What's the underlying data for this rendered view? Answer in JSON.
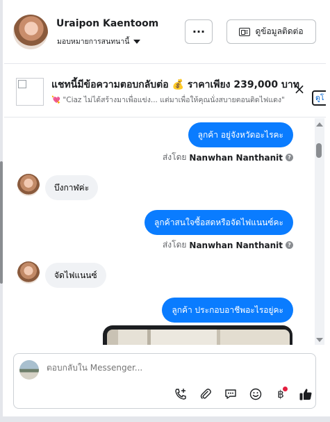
{
  "header": {
    "name": "Uraipon Kaentoom",
    "assign_label": "มอบหมายการสนทนานี้",
    "more_label": "···",
    "contact_label": "ดูข้อมูลติดต่อ"
  },
  "ad": {
    "title": "แชทนี้มีข้อความตอบกลับต่อ 💰 ราคาเพียง 239,000 บาท",
    "subtitle_icon": "💘",
    "subtitle": "\"Ciaz ไม่ได้สร้างมาเพื่อแข่ง... แต่มาเพื่อให้คุณนั่งสบายตอนติดไฟแดง\"",
    "close_label": "×",
    "view_label": "ดูโ"
  },
  "messages": [
    {
      "direction": "out",
      "text": "ลูกค้า อยู่จังหวัดอะไรคะ",
      "sent_by_prefix": "ส่งโดย",
      "sent_by": "Nanwhan Nanthanit"
    },
    {
      "direction": "in",
      "text": "บึงกาฬค่ะ"
    },
    {
      "direction": "out",
      "text": "ลูกค้าสนใจซื้อสดหรือจัดไฟแนนซ์คะ",
      "sent_by_prefix": "ส่งโดย",
      "sent_by": "Nanwhan Nanthanit"
    },
    {
      "direction": "in",
      "text": "จัดไฟแนนซ์"
    },
    {
      "direction": "out",
      "text": "ลูกค้า ประกอบอาชีพอะไรอยู่คะ"
    }
  ],
  "composer": {
    "placeholder": "ตอบกลับใน Messenger...",
    "tools": [
      "add-call-icon",
      "paperclip-icon",
      "saved-reply-icon",
      "emoji-icon",
      "baht-payment-icon",
      "like-icon"
    ]
  },
  "colors": {
    "accent": "#0a7cff",
    "incoming_bubble": "#f0f2f5",
    "notification_dot": "#e41e3f"
  }
}
